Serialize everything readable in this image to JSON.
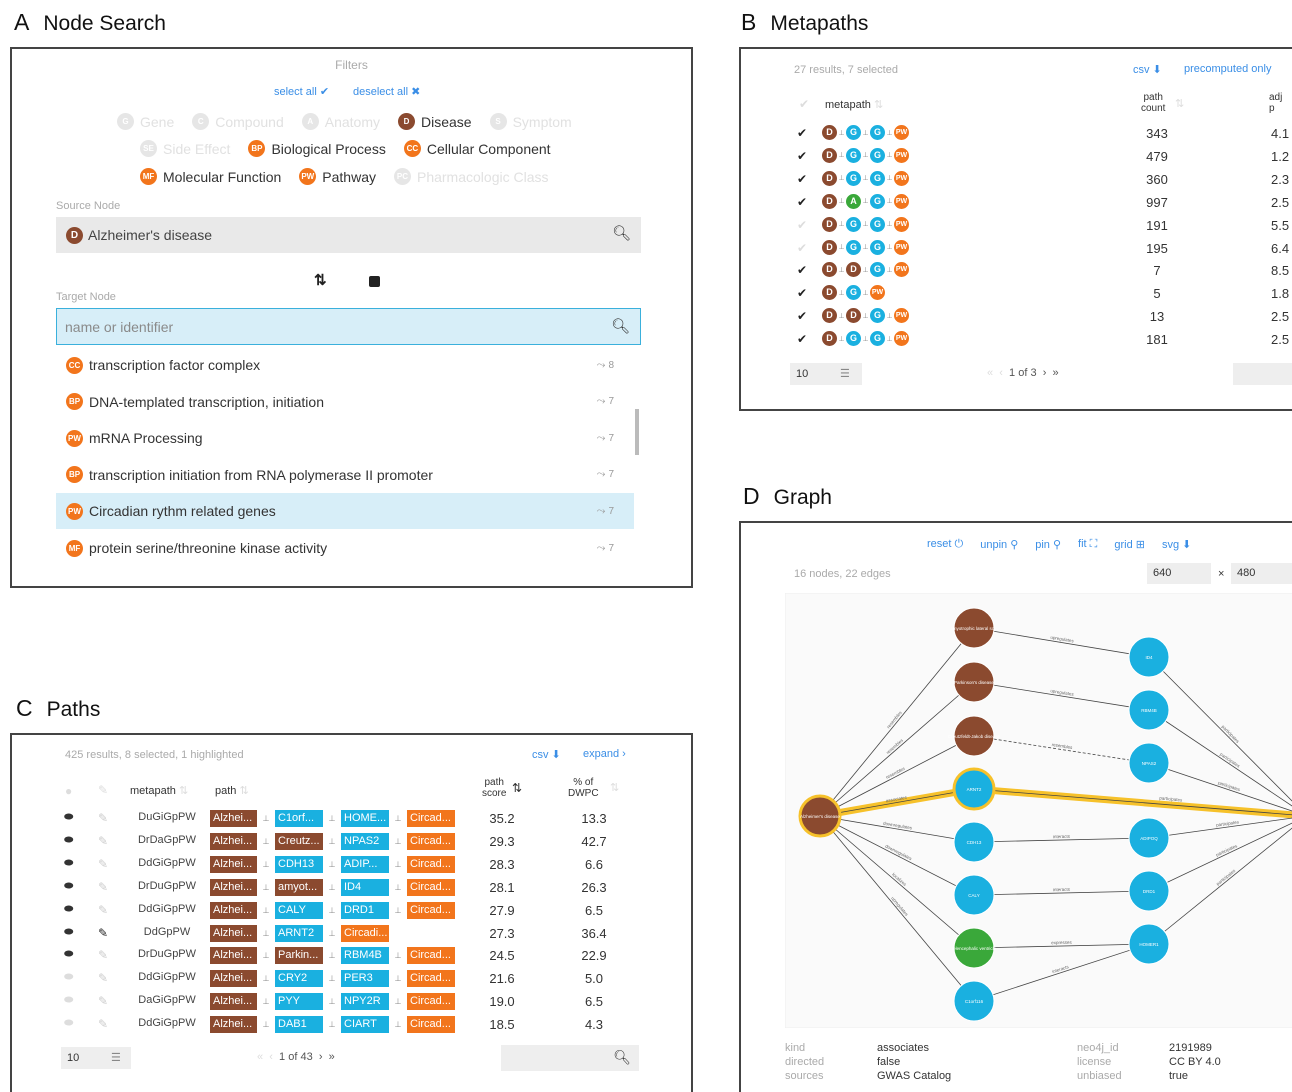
{
  "colors": {
    "disease": "#8b4a2f",
    "gene": "#1ab0e0",
    "anatomy": "#3aa83a",
    "orange": "#f2751c",
    "highlight": "#f6c12a",
    "link": "#3a8ee6",
    "panel_border": "#444444"
  },
  "panelA": {
    "letter": "A",
    "title": "Node Search",
    "filters_label": "Filters",
    "select_all": "select all ✔",
    "deselect_all": "deselect all ✖",
    "filters": [
      {
        "code": "G",
        "label": "Gene",
        "active": false,
        "color": "#1ab0e0"
      },
      {
        "code": "C",
        "label": "Compound",
        "active": false,
        "color": "#f2751c"
      },
      {
        "code": "A",
        "label": "Anatomy",
        "active": false,
        "color": "#3aa83a"
      },
      {
        "code": "D",
        "label": "Disease",
        "active": true,
        "color": "#8b4a2f"
      },
      {
        "code": "S",
        "label": "Symptom",
        "active": false,
        "color": "#8b4a2f"
      },
      {
        "code": "SE",
        "label": "Side Effect",
        "active": false,
        "color": "#8b4a2f"
      },
      {
        "code": "BP",
        "label": "Biological Process",
        "active": true,
        "color": "#f2751c"
      },
      {
        "code": "CC",
        "label": "Cellular Component",
        "active": true,
        "color": "#f2751c"
      },
      {
        "code": "MF",
        "label": "Molecular Function",
        "active": true,
        "color": "#f2751c"
      },
      {
        "code": "PW",
        "label": "Pathway",
        "active": true,
        "color": "#f2751c"
      },
      {
        "code": "PC",
        "label": "Pharmacologic Class",
        "active": false,
        "color": "#f2751c"
      }
    ],
    "source_label": "Source Node",
    "source_badge": "D",
    "source_value": "Alzheimer's disease",
    "swap_icon": "⇅",
    "target_label": "Target Node",
    "target_placeholder": "name or identifier",
    "dropdown": [
      {
        "code": "CC",
        "label": "transcription factor complex",
        "count": "8",
        "selected": false
      },
      {
        "code": "BP",
        "label": "DNA-templated transcription, initiation",
        "count": "7",
        "selected": false
      },
      {
        "code": "PW",
        "label": "mRNA Processing",
        "count": "7",
        "selected": false
      },
      {
        "code": "BP",
        "label": "transcription initiation from RNA polymerase II promoter",
        "count": "7",
        "selected": false
      },
      {
        "code": "PW",
        "label": "Circadian rythm related genes",
        "count": "7",
        "selected": true
      },
      {
        "code": "MF",
        "label": "protein serine/threonine kinase activity",
        "count": "7",
        "selected": false
      }
    ]
  },
  "panelB": {
    "letter": "B",
    "title": "Metapaths",
    "summary": "27 results, 7 selected",
    "csv": "csv ⬇",
    "precomputed": "precomputed only",
    "col_metapath": "metapath",
    "col_path_count_1": "path",
    "col_path_count_2": "count",
    "col_adj_1": "adj",
    "col_adj_2": "p",
    "rows": [
      {
        "checked": true,
        "nodes": [
          "D",
          "G",
          "G",
          "PW"
        ],
        "count": "343",
        "adj": "4.1"
      },
      {
        "checked": true,
        "nodes": [
          "D",
          "G",
          "G",
          "PW"
        ],
        "count": "479",
        "adj": "1.2"
      },
      {
        "checked": true,
        "nodes": [
          "D",
          "G",
          "G",
          "PW"
        ],
        "count": "360",
        "adj": "2.3"
      },
      {
        "checked": true,
        "nodes": [
          "D",
          "A",
          "G",
          "PW"
        ],
        "count": "997",
        "adj": "2.5"
      },
      {
        "checked": false,
        "nodes": [
          "D",
          "G",
          "G",
          "PW"
        ],
        "count": "191",
        "adj": "5.5"
      },
      {
        "checked": false,
        "nodes": [
          "D",
          "G",
          "G",
          "PW"
        ],
        "count": "195",
        "adj": "6.4"
      },
      {
        "checked": true,
        "nodes": [
          "D",
          "D",
          "G",
          "PW"
        ],
        "count": "7",
        "adj": "8.5"
      },
      {
        "checked": true,
        "nodes": [
          "D",
          "G",
          "PW"
        ],
        "count": "5",
        "adj": "1.8"
      },
      {
        "checked": true,
        "nodes": [
          "D",
          "D",
          "G",
          "PW"
        ],
        "count": "13",
        "adj": "2.5"
      },
      {
        "checked": true,
        "nodes": [
          "D",
          "G",
          "G",
          "PW"
        ],
        "count": "181",
        "adj": "2.5"
      }
    ],
    "page_size": "10",
    "pager": "1 of 3"
  },
  "panelC": {
    "letter": "C",
    "title": "Paths",
    "summary": "425 results, 8 selected, 1 highlighted",
    "csv": "csv ⬇",
    "expand": "expand ›",
    "col_metapath": "metapath",
    "col_path": "path",
    "col_score_1": "path",
    "col_score_2": "score",
    "col_dwpc_1": "% of",
    "col_dwpc_2": "DWPC",
    "rows": [
      {
        "eye": true,
        "pin": false,
        "metapath": "DuGiGpPW",
        "chips": [
          "Alzhei...",
          "C1orf...",
          "HOME...",
          "Circad..."
        ],
        "kinds": [
          "D",
          "G",
          "G",
          "PW"
        ],
        "score": "35.2",
        "dwpc": "13.3"
      },
      {
        "eye": true,
        "pin": false,
        "metapath": "DrDaGpPW",
        "chips": [
          "Alzhei...",
          "Creutz...",
          "NPAS2",
          "Circad..."
        ],
        "kinds": [
          "D",
          "D",
          "G",
          "PW"
        ],
        "score": "29.3",
        "dwpc": "42.7"
      },
      {
        "eye": true,
        "pin": false,
        "metapath": "DdGiGpPW",
        "chips": [
          "Alzhei...",
          "CDH13",
          "ADIP...",
          "Circad..."
        ],
        "kinds": [
          "D",
          "G",
          "G",
          "PW"
        ],
        "score": "28.3",
        "dwpc": "6.6"
      },
      {
        "eye": true,
        "pin": false,
        "metapath": "DrDuGpPW",
        "chips": [
          "Alzhei...",
          "amyot...",
          "ID4",
          "Circad..."
        ],
        "kinds": [
          "D",
          "D",
          "G",
          "PW"
        ],
        "score": "28.1",
        "dwpc": "26.3"
      },
      {
        "eye": true,
        "pin": false,
        "metapath": "DdGiGpPW",
        "chips": [
          "Alzhei...",
          "CALY",
          "DRD1",
          "Circad..."
        ],
        "kinds": [
          "D",
          "G",
          "G",
          "PW"
        ],
        "score": "27.9",
        "dwpc": "6.5"
      },
      {
        "eye": true,
        "pin": true,
        "metapath": "DdGpPW",
        "chips": [
          "Alzhei...",
          "ARNT2",
          "Circadi..."
        ],
        "kinds": [
          "D",
          "G",
          "PW"
        ],
        "score": "27.3",
        "dwpc": "36.4"
      },
      {
        "eye": true,
        "pin": false,
        "metapath": "DrDuGpPW",
        "chips": [
          "Alzhei...",
          "Parkin...",
          "RBM4B",
          "Circad..."
        ],
        "kinds": [
          "D",
          "D",
          "G",
          "PW"
        ],
        "score": "24.5",
        "dwpc": "22.9"
      },
      {
        "eye": false,
        "pin": false,
        "metapath": "DdGiGpPW",
        "chips": [
          "Alzhei...",
          "CRY2",
          "PER3",
          "Circad..."
        ],
        "kinds": [
          "D",
          "G",
          "G",
          "PW"
        ],
        "score": "21.6",
        "dwpc": "5.0"
      },
      {
        "eye": false,
        "pin": false,
        "metapath": "DaGiGpPW",
        "chips": [
          "Alzhei...",
          "PYY",
          "NPY2R",
          "Circad..."
        ],
        "kinds": [
          "D",
          "G",
          "G",
          "PW"
        ],
        "score": "19.0",
        "dwpc": "6.5"
      },
      {
        "eye": false,
        "pin": false,
        "metapath": "DdGiGpPW",
        "chips": [
          "Alzhei...",
          "DAB1",
          "CIART",
          "Circad..."
        ],
        "kinds": [
          "D",
          "G",
          "G",
          "PW"
        ],
        "score": "18.5",
        "dwpc": "4.3"
      }
    ],
    "page_size": "10",
    "pager": "1 of 43"
  },
  "panelD": {
    "letter": "D",
    "title": "Graph",
    "buttons": [
      "reset ⏻",
      "unpin ⚲",
      "pin ⚲",
      "fit ⛶",
      "grid ⊞",
      "svg ⬇"
    ],
    "summary": "16 nodes, 22 edges",
    "width": "640",
    "times": "×",
    "height": "480",
    "source_node": "Alzheimer's disease",
    "nodes_left": [
      {
        "label": "amyotrophic lateral sc...",
        "kind": "D"
      },
      {
        "label": "Parkinson's disease",
        "kind": "D"
      },
      {
        "label": "Creutzfeldt-Jakob disease",
        "kind": "D"
      },
      {
        "label": "ARNT2",
        "kind": "G"
      },
      {
        "label": "CDH13",
        "kind": "G"
      },
      {
        "label": "CALY",
        "kind": "G"
      },
      {
        "label": "telencephalic ventricle",
        "kind": "A"
      },
      {
        "label": "C1orf116",
        "kind": "G"
      }
    ],
    "nodes_right": [
      {
        "label": "ID4",
        "kind": "G"
      },
      {
        "label": "RBM4B",
        "kind": "G"
      },
      {
        "label": "NPAS2",
        "kind": "G"
      },
      {
        "label": "ADIPOQ",
        "kind": "G"
      },
      {
        "label": "DRD1",
        "kind": "G"
      },
      {
        "label": "HOMER1",
        "kind": "G"
      }
    ],
    "left_edges": [
      "resembles",
      "resembles",
      "resembles",
      "associates",
      "downregulates",
      "downregulates",
      "localizes",
      "upregulates"
    ],
    "mid_edges": [
      "upregulates",
      "upregulates",
      "resembles",
      "",
      "interacts",
      "interacts",
      "expresses",
      "interacts"
    ],
    "right_edges": [
      "participates",
      "participates",
      "participates",
      "participates",
      "participates",
      "participates"
    ],
    "props": {
      "kind_label": "kind",
      "kind_value": "associates",
      "directed_label": "directed",
      "directed_value": "false",
      "sources_label": "sources",
      "sources_value": "GWAS Catalog",
      "neo4j_label": "neo4j_id",
      "neo4j_value": "2191989",
      "license_label": "license",
      "license_value": "CC BY 4.0",
      "unbiased_label": "unbiased",
      "unbiased_value": "true"
    }
  }
}
